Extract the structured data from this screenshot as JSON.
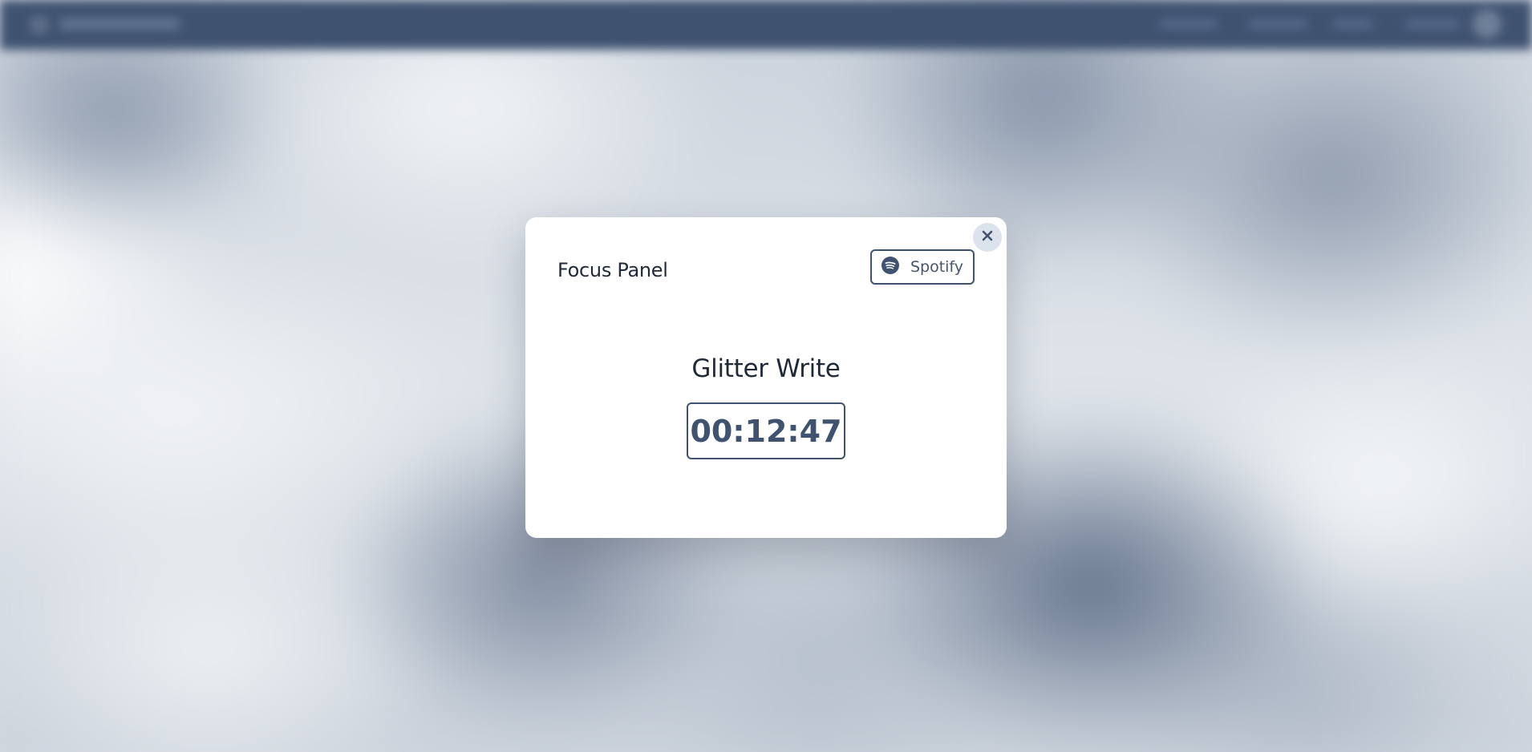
{
  "modal": {
    "title": "Focus Panel",
    "spotify_label": "Spotify",
    "project_name": "Glitter Write",
    "timer": "00:12:47"
  },
  "icons": {
    "close": "close-icon",
    "spotify": "spotify-icon"
  },
  "colors": {
    "accent": "#3f5370",
    "close_bg": "#dde3ec",
    "topbar": "#3f5370"
  }
}
